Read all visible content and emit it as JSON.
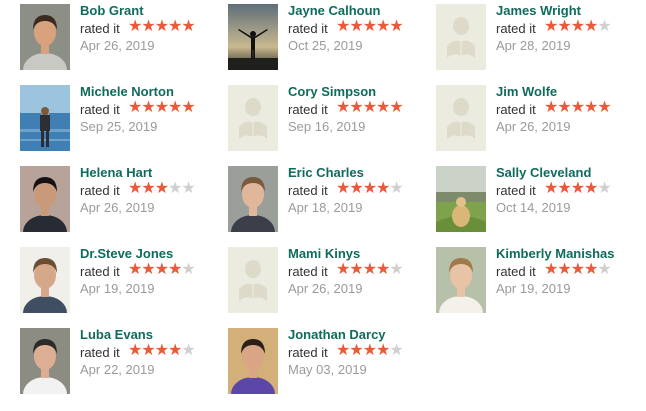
{
  "colors": {
    "name": "#0f6b5c",
    "star_on": "#ea5a3a",
    "star_off": "#d0d0d0",
    "rated_text": "#333333",
    "date_text": "#9a9a9a",
    "placeholder_bg": "#ecebdf",
    "placeholder_fg": "#dddac9"
  },
  "rated_label": "rated it",
  "reviews": [
    {
      "name": "Bob Grant",
      "rating": 5,
      "date": "Apr 26, 2019",
      "avatar": "photo-bob"
    },
    {
      "name": "Jayne Calhoun",
      "rating": 5,
      "date": "Oct 25, 2019",
      "avatar": "photo-silhouette-sky"
    },
    {
      "name": "James Wright",
      "rating": 4,
      "date": "Apr 28, 2019",
      "avatar": "placeholder-reader"
    },
    {
      "name": "Michele Norton",
      "rating": 5,
      "date": "Sep 25, 2019",
      "avatar": "photo-sea"
    },
    {
      "name": "Cory Simpson",
      "rating": 5,
      "date": "Sep 16, 2019",
      "avatar": "placeholder-reader"
    },
    {
      "name": "Jim Wolfe",
      "rating": 5,
      "date": "Apr 26, 2019",
      "avatar": "placeholder-reader"
    },
    {
      "name": "Helena Hart",
      "rating": 3,
      "date": "Apr 26, 2019",
      "avatar": "photo-helena"
    },
    {
      "name": "Eric Charles",
      "rating": 4,
      "date": "Apr 18, 2019",
      "avatar": "photo-eric"
    },
    {
      "name": "Sally Cleveland",
      "rating": 4,
      "date": "Oct 14, 2019",
      "avatar": "photo-field"
    },
    {
      "name": "Dr.Steve Jones",
      "rating": 4,
      "date": "Apr 19, 2019",
      "avatar": "photo-steve"
    },
    {
      "name": "Mami Kinys",
      "rating": 4,
      "date": "Apr 26, 2019",
      "avatar": "placeholder-reader"
    },
    {
      "name": "Kimberly Manishas",
      "rating": 4,
      "date": "Apr 19, 2019",
      "avatar": "photo-kimberly"
    },
    {
      "name": "Luba Evans",
      "rating": 4,
      "date": "Apr 22, 2019",
      "avatar": "photo-luba"
    },
    {
      "name": "Jonathan Darcy",
      "rating": 4,
      "date": "May 03, 2019",
      "avatar": "photo-jonathan"
    }
  ]
}
